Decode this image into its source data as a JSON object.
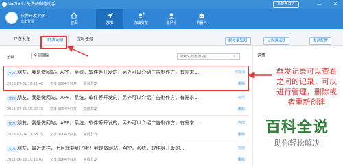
{
  "titlebar": {
    "title": "WeTool - 免费的微信助手",
    "activate": "功能未激活",
    "minimize": "—",
    "close": "✕"
  },
  "account": {
    "name": "软件开发-阿K",
    "status": "退出登录"
  },
  "nav": [
    {
      "label": "首页",
      "icon": "home-icon"
    },
    {
      "label": "群发",
      "icon": "send-icon",
      "active": true
    },
    {
      "label": "加群好友",
      "icon": "add-friend-icon"
    },
    {
      "label": "僵尸粉",
      "icon": "zombie-fans-icon"
    },
    {
      "label": "机器人",
      "icon": "robot-icon"
    }
  ],
  "tabs": [
    "正在发送",
    "群发记录",
    "定时任务"
  ],
  "top_buttons": [
    "群发编辑器",
    "公告编辑器",
    "发送配置"
  ],
  "filter": {
    "select_all": "全部",
    "delete_all": "全部删除",
    "search_placeholder": "搜索文本消息内容"
  },
  "records": [
    {
      "type": "文本",
      "content": "朋友，我是做网站，APP，系统，软件等开发的，另外可以介绍广告制作方，有需求...",
      "status": "已取消",
      "time": "2018-07-31 16:22:48",
      "count": "文本 3064个好友",
      "state": "取消群发",
      "action": "删除",
      "highlight": true
    },
    {
      "type": "文本",
      "content": "朋友，我是做网站，APP，系统，软件等开发的，另外可以介绍广告制作方，有需求...",
      "status": "完成",
      "time": "2018-07-25 15:02:19",
      "count": "文本 3064个好友",
      "state": "完成群发",
      "action": "删除"
    },
    {
      "type": "文本",
      "content": "朋友，我是做网站，APP，系统，软件等开发的，另外可以介绍广告制作方，有需求...",
      "status": "完成",
      "time": "2018-07-04 11:43:29",
      "count": "文本 3064个好友",
      "state": "完成群发",
      "action": "删除"
    },
    {
      "type": "文本",
      "content": "朋友，最近怎样，七月就要到了哦！我是做网站，APP，系统，软件等开发的...",
      "status": "完成",
      "time": "2018-06-28 10:15:02",
      "count": "文本 3064个好友",
      "state": "完成群发",
      "action": "删除"
    }
  ],
  "details": {
    "title": "详情"
  },
  "annotation": "群发记录可以查看之间的记录，可以进行管理，删除或者重新创建",
  "watermark": {
    "title": "百科全说",
    "subtitle": "助你轻松解决"
  },
  "colors": {
    "primary": "#2f86d6",
    "highlight": "#e03a3a",
    "watermark": "#2f7d3a"
  }
}
